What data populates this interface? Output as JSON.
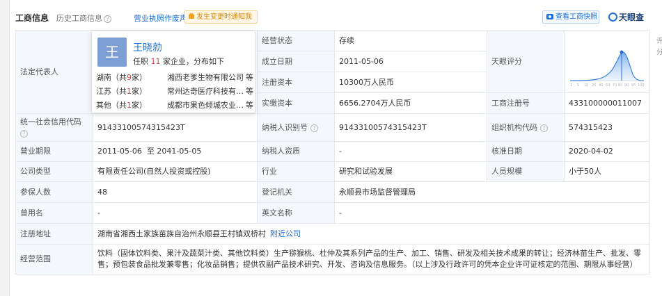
{
  "header": {
    "tab_main": "工商信息",
    "tab_history": "历史工商信息",
    "tab_history_icon": "question-icon",
    "tab_license": "营业执照作废声明",
    "notify_label": "发生变更时通知我",
    "snapshot_label": "查看工商快照",
    "logo_text": "天眼查"
  },
  "popup": {
    "avatar_char": "王",
    "name": "王晓勍",
    "summary_prefix": "任职",
    "summary_count": "11",
    "summary_suffix": "家企业，分布如下",
    "rows": [
      {
        "region": "湖南",
        "count_prefix": "（共",
        "count": "9",
        "count_suffix": "家）",
        "company": "湘西老爹生物有限公司",
        "etc": "等"
      },
      {
        "region": "江苏",
        "count_prefix": "（共",
        "count": "1",
        "count_suffix": "家）",
        "company": "常州达奇医疗科技有…",
        "etc": "等"
      },
      {
        "region": "其他",
        "count_prefix": "（共",
        "count": "1",
        "count_suffix": "家）",
        "company": "成都市果色倾城农业…",
        "etc": "等"
      }
    ]
  },
  "table": {
    "legal_rep_label": "法定代表人",
    "status_label": "经营状态",
    "status_value": "存续",
    "rating_label": "天眼评分",
    "rating_title": "评分",
    "rating_value": "89",
    "found_label": "成立日期",
    "found_value": "2011-05-06",
    "reg_cap_label": "注册资本",
    "reg_cap_value": "10300万人民币",
    "paid_cap_label": "实缴资本",
    "paid_cap_value": "6656.2704万人民币",
    "reg_no_label": "工商注册号",
    "reg_no_value": "433100000011007",
    "credit_code_label": "统一社会信用代码",
    "credit_code_value": "91433100574315423T",
    "taxpayer_id_label": "纳税人识别号",
    "taxpayer_id_value": "91433100574315423T",
    "org_code_label": "组织机构代码",
    "org_code_value": "574315423",
    "term_label": "营业期限",
    "term_value": "2011-05-06  至 2041-05-05",
    "taxpayer_qual_label": "纳税人资质",
    "taxpayer_qual_value": "-",
    "approve_label": "核准日期",
    "approve_value": "2020-04-02",
    "type_label": "公司类型",
    "type_value": "有限责任公司(自然人投资或控股)",
    "industry_label": "行业",
    "industry_value": "研究和试验发展",
    "scale_label": "人员规模",
    "scale_value": "小于50人",
    "insured_label": "参保人数",
    "insured_value": "48",
    "authority_label": "登记机关",
    "authority_value": "永顺县市场监督管理局",
    "former_name_label": "曾用名",
    "former_name_value": "-",
    "en_name_label": "英文名称",
    "en_name_value": "-",
    "address_label": "注册地址",
    "address_value": "湖南省湘西土家族苗族自治州永顺县王村镇双桥村",
    "address_link": "附近公司",
    "scope_label": "经营范围",
    "scope_value": "饮料（固体饮料类、果汁及蔬菜汁类、其他饮料类）生产猕猴桃、杜仲及其系列产品的生产、加工、销售、研发及相关技术成果的转让；经济林苗生产、批发、零售；预包装食品批发兼零售；化妆品销售；提供农副产品技术研究、开发、咨询及信息服务。（以上涉及行政许可的凭本企业许可证核定的范围、期限从事经营）"
  },
  "colors": {
    "accent": "#1c6fd6",
    "highlight": "#e53e3e",
    "label_bg": "#f4f7fb"
  }
}
